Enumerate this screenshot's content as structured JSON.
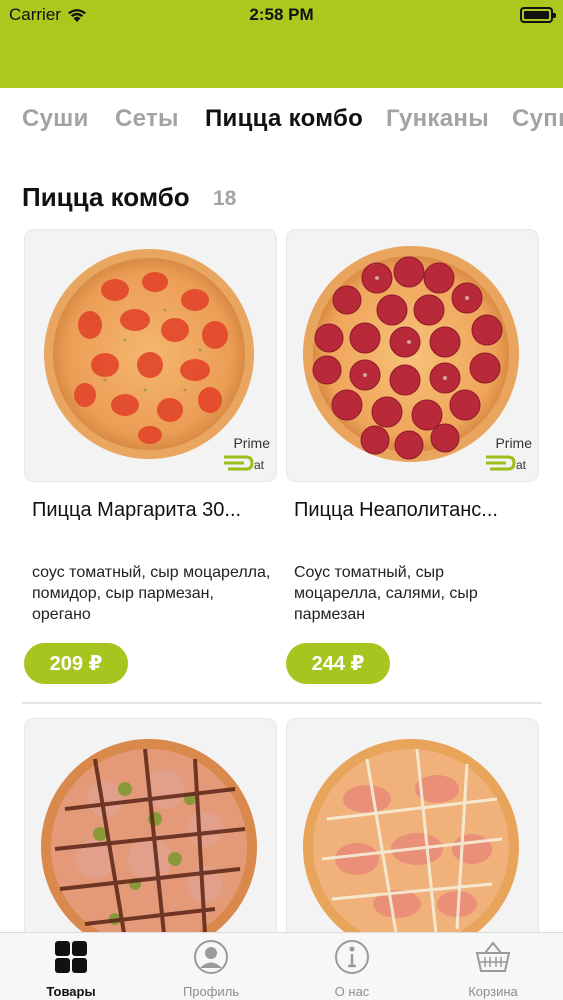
{
  "status_bar": {
    "carrier": "Carrier",
    "time": "2:58 PM"
  },
  "categories": [
    {
      "label": "Суши",
      "active": false
    },
    {
      "label": "Сеты",
      "active": false
    },
    {
      "label": "Пицца комбо",
      "active": true
    },
    {
      "label": "Гунканы",
      "active": false
    },
    {
      "label": "Супы",
      "active": false
    }
  ],
  "section": {
    "title": "Пицца комбо",
    "count": "18"
  },
  "products": [
    {
      "name": "Пицца Маргарита 30...",
      "description": "соус томатный, сыр моцарелла, помидор, сыр пармезан, орегано",
      "price": "209 ₽"
    },
    {
      "name": "Пицца Неаполитанс...",
      "description": "Соус томатный, сыр моцарелла, салями, сыр пармезан",
      "price": "244 ₽"
    }
  ],
  "logo_text": "Prime",
  "tabbar": [
    {
      "label": "Товары",
      "icon": "grid-icon",
      "active": true
    },
    {
      "label": "Профиль",
      "icon": "profile-icon",
      "active": false
    },
    {
      "label": "О нас",
      "icon": "info-icon",
      "active": false
    },
    {
      "label": "Корзина",
      "icon": "basket-icon",
      "active": false
    }
  ],
  "colors": {
    "brand": "#aec71f",
    "price_bg": "#a7c51f",
    "inactive": "#a3a3a3"
  }
}
